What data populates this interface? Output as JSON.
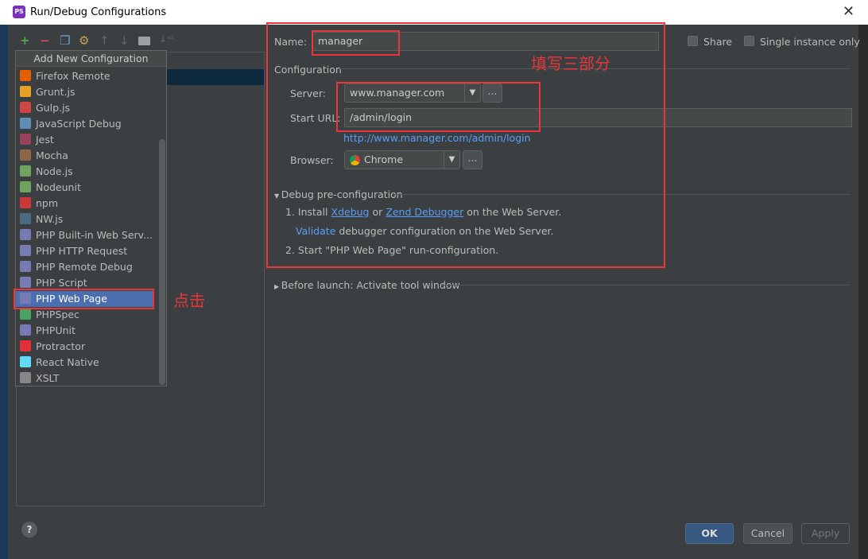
{
  "window": {
    "title": "Run/Debug Configurations",
    "app_icon": "PS"
  },
  "toolbar": {
    "icons": [
      "plus-icon",
      "minus-icon",
      "copy-icon",
      "wrench-icon",
      "arrow-up-icon",
      "arrow-down-icon",
      "folder-icon",
      "sort-az-icon"
    ]
  },
  "popup": {
    "header": "Add New Configuration",
    "items": [
      {
        "label": "Firefox Remote",
        "color": "#e66000"
      },
      {
        "label": "Grunt.js",
        "color": "#e4a125"
      },
      {
        "label": "Gulp.js",
        "color": "#cf4647"
      },
      {
        "label": "JavaScript Debug",
        "color": "#5f8db5"
      },
      {
        "label": "Jest",
        "color": "#99425b"
      },
      {
        "label": "Mocha",
        "color": "#8d6748"
      },
      {
        "label": "Node.js",
        "color": "#6da55f"
      },
      {
        "label": "Nodeunit",
        "color": "#6da55f"
      },
      {
        "label": "npm",
        "color": "#cb3837"
      },
      {
        "label": "NW.js",
        "color": "#4a6b82"
      },
      {
        "label": "PHP Built-in Web Serv...",
        "color": "#777bb3"
      },
      {
        "label": "PHP HTTP Request",
        "color": "#777bb3"
      },
      {
        "label": "PHP Remote Debug",
        "color": "#777bb3"
      },
      {
        "label": "PHP Script",
        "color": "#777bb3"
      },
      {
        "label": "PHP Web Page",
        "color": "#777bb3"
      },
      {
        "label": "PHPSpec",
        "color": "#4aa564"
      },
      {
        "label": "PHPUnit",
        "color": "#777bb3"
      },
      {
        "label": "Protractor",
        "color": "#e23237"
      },
      {
        "label": "React Native",
        "color": "#61dafb"
      },
      {
        "label": "XSLT",
        "color": "#888888"
      }
    ],
    "selected": "PHP Web Page"
  },
  "form": {
    "name_label": "Name:",
    "name_value": "manager",
    "share_label": "Share",
    "single_instance_label": "Single instance only",
    "configuration_label": "Configuration",
    "server_label": "Server:",
    "server_value": "www.manager.com",
    "start_url_label": "Start URL:",
    "start_url_value": "/admin/login",
    "resolved_url": "http://www.manager.com/admin/login",
    "browser_label": "Browser:",
    "browser_value": "Chrome",
    "ellipsis": "...",
    "debug_section": "Debug pre-configuration",
    "step1_prefix": "1. Install",
    "xdebug": "Xdebug",
    "or": "or",
    "zend": "Zend Debugger",
    "step1_suffix": "on the Web Server.",
    "validate": "Validate",
    "validate_suffix": "debugger configuration on the Web Server.",
    "step2": "2. Start \"PHP Web Page\" run-configuration.",
    "before_launch": "Before launch: Activate tool window"
  },
  "buttons": {
    "ok": "OK",
    "cancel": "Cancel",
    "apply": "Apply",
    "help": "?"
  },
  "annotations": {
    "fill_three_parts": "填写三部分",
    "click": "点击",
    "color": "#e8363a"
  }
}
